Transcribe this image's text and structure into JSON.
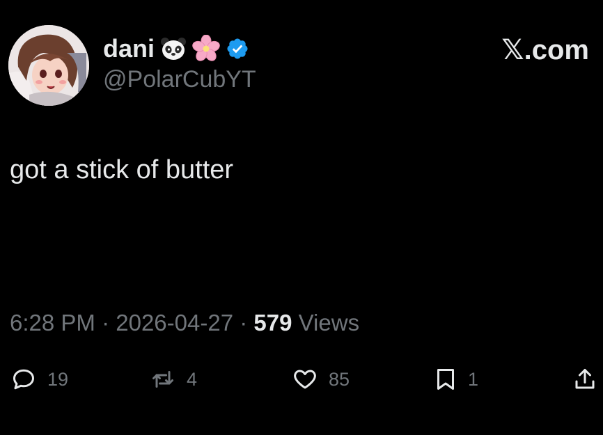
{
  "author": {
    "display_name": "dani",
    "name_emojis": [
      "panda-face-icon",
      "cherry-blossom-icon"
    ],
    "verified": true,
    "handle": "@PolarCubYT"
  },
  "brand": "𝕏.com",
  "tweet": {
    "text": "got a stick of butter"
  },
  "meta": {
    "time": "6:28 PM",
    "separator": "·",
    "date": "2026-04-27",
    "views_count": "579",
    "views_label": "Views"
  },
  "actions": {
    "reply_count": "19",
    "repost_count": "4",
    "like_count": "85",
    "bookmark_count": "1"
  },
  "colors": {
    "background": "#000000",
    "text_primary": "#e7e9ea",
    "text_secondary": "#71767b",
    "verified_badge": "#1d9bf0"
  }
}
